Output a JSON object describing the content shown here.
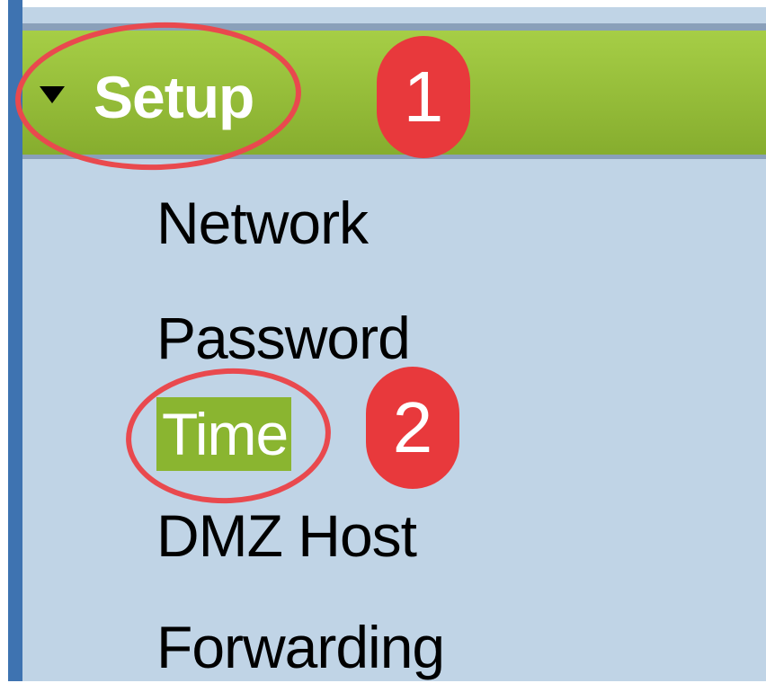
{
  "sidebar": {
    "section": {
      "label": "Setup",
      "expanded": true,
      "items": [
        {
          "label": "Network"
        },
        {
          "label": "Password"
        },
        {
          "label": "Time",
          "selected": true
        },
        {
          "label": "DMZ Host"
        },
        {
          "label": "Forwarding"
        }
      ]
    }
  },
  "annotations": {
    "step1": "1",
    "step2": "2",
    "highlight_color": "#e9494e"
  },
  "colors": {
    "header_green": "#93b93a",
    "selected_green": "#8ab530",
    "panel_blue": "#c0d4e6",
    "rail_blue": "#3e73b1"
  }
}
